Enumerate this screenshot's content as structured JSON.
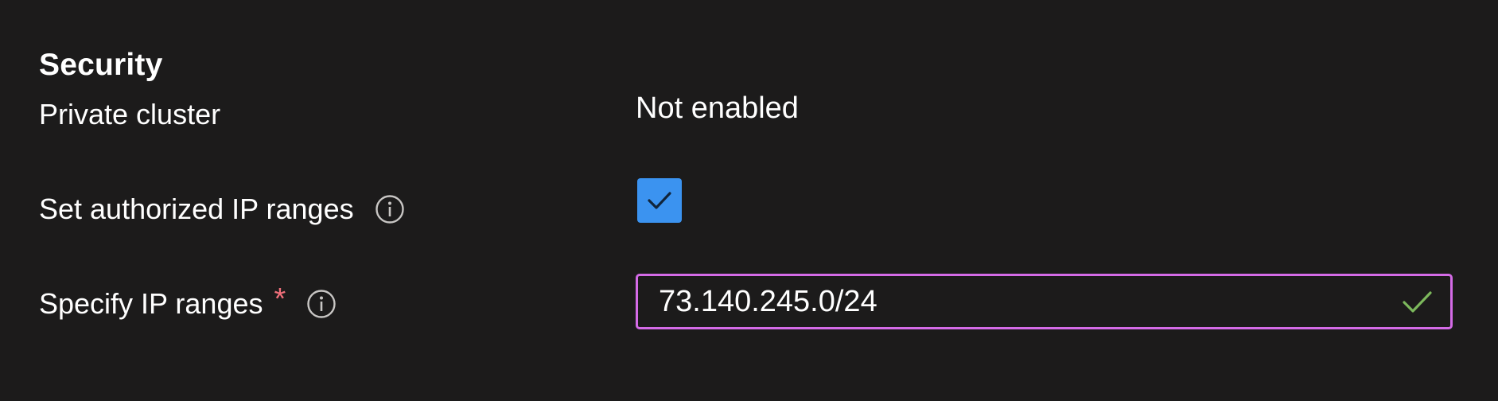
{
  "section": {
    "title": "Security"
  },
  "rows": {
    "private_cluster": {
      "label": "Private cluster",
      "value": "Not enabled"
    },
    "authorized_ip": {
      "label": "Set authorized IP ranges",
      "info_icon": "info-icon",
      "checked": true
    },
    "ip_ranges": {
      "label": "Specify IP ranges",
      "required_marker": "*",
      "info_icon": "info-icon",
      "value": "73.140.245.0/24",
      "validation_icon": "checkmark-icon"
    }
  },
  "colors": {
    "background": "#1c1b1b",
    "text": "#ffffff",
    "checkbox_fill": "#3b93f0",
    "field_focus_border": "#d46be7",
    "required": "#f1707b",
    "valid_check": "#7cb85c",
    "info_icon": "#c8c6c4"
  }
}
